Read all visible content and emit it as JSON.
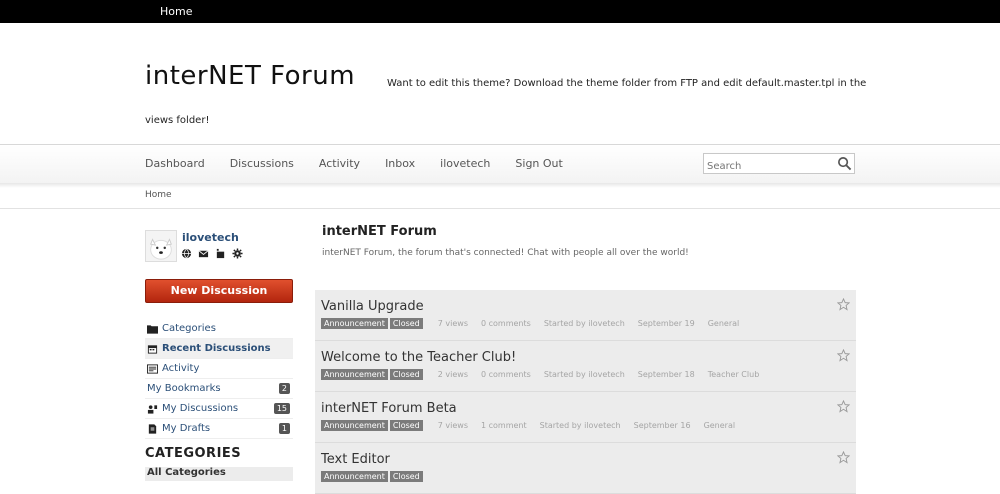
{
  "topbar": {
    "home": "Home"
  },
  "banner": {
    "title": "interNET Forum",
    "tagline_line1": "Want to edit this theme? Download the theme folder from FTP and edit default.master.tpl in the",
    "tagline_line2": "views folder!"
  },
  "menu": [
    "Dashboard",
    "Discussions",
    "Activity",
    "Inbox",
    "ilovetech",
    "Sign Out"
  ],
  "search": {
    "placeholder": "Search"
  },
  "breadcrumb": "Home",
  "user": {
    "name": "ilovetech"
  },
  "new_discussion": "New Discussion",
  "nav": [
    {
      "label": "Categories",
      "icon": "folder-icon",
      "count": ""
    },
    {
      "label": "Recent Discussions",
      "icon": "calendar-icon",
      "count": ""
    },
    {
      "label": "Activity",
      "icon": "activity-icon",
      "count": ""
    },
    {
      "label": "My Bookmarks",
      "icon": "",
      "count": "2"
    },
    {
      "label": "My Discussions",
      "icon": "discussions-icon",
      "count": "15"
    },
    {
      "label": "My Drafts",
      "icon": "draft-icon",
      "count": "1"
    }
  ],
  "categories_heading": "CATEGORIES",
  "categories_first": {
    "label": "All Categories",
    "count": ""
  },
  "main": {
    "title": "interNET Forum",
    "description": "interNET Forum, the forum that's connected! Chat with people all over the world!"
  },
  "discussions": [
    {
      "title": "Vanilla Upgrade",
      "tags": [
        "Announcement",
        "Closed"
      ],
      "views": "7 views",
      "comments": "0 comments",
      "started": "Started by ilovetech",
      "date": "September 19",
      "category": "General"
    },
    {
      "title": "Welcome to the Teacher Club!",
      "tags": [
        "Announcement",
        "Closed"
      ],
      "views": "2 views",
      "comments": "0 comments",
      "started": "Started by ilovetech",
      "date": "September 18",
      "category": "Teacher Club"
    },
    {
      "title": "interNET Forum Beta",
      "tags": [
        "Announcement",
        "Closed"
      ],
      "views": "7 views",
      "comments": "1 comment",
      "started": "Started by ilovetech",
      "date": "September 16",
      "category": "General"
    },
    {
      "title": "Text Editor",
      "tags": [
        "Announcement",
        "Closed"
      ],
      "views": "",
      "comments": "",
      "started": "",
      "date": "",
      "category": ""
    }
  ],
  "colors": {
    "accent_red": "#c8361a",
    "link_blue": "#2b4f78",
    "tag_gray": "#7b7b7b"
  }
}
